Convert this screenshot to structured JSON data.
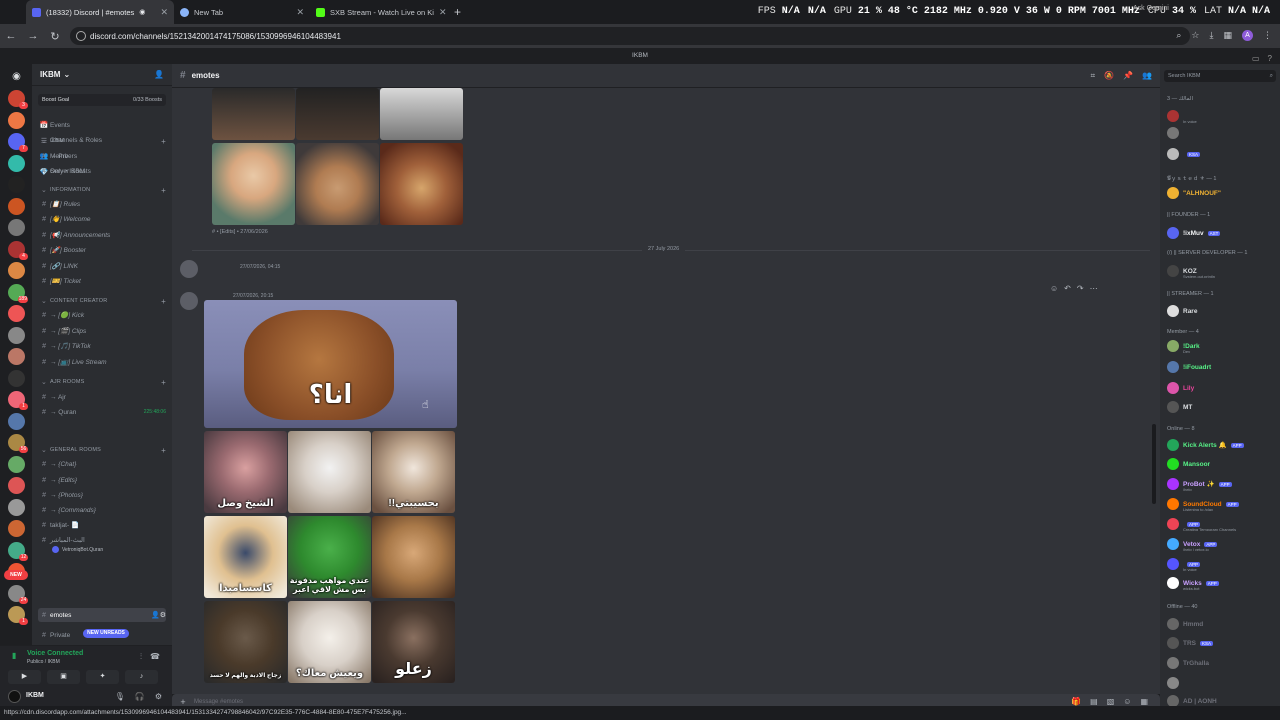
{
  "browser": {
    "tabs": [
      {
        "title": "(18332) Discord | #emotes",
        "color": "#5865f2"
      },
      {
        "title": "New Tab",
        "color": "#8ab4f8"
      },
      {
        "title": "SXB Stream - Watch Live on Ki",
        "color": "#53fc18"
      }
    ],
    "new_tab": "+",
    "ask": "Ask Gemini",
    "url": "discord.com/channels/1521342001474175086/1530996946104483941",
    "status_url": "https://cdn.discordapp.com/attachments/1530996946104483941/1531334274798846042/97C92E35-776C-4884-8E80-475E7F475256.jpg..."
  },
  "hud": [
    {
      "label": "FPS",
      "value": "N/A"
    },
    {
      "label": "N/A",
      "value": ""
    },
    {
      "label": "GPU",
      "value": "21 % 48 °C 2182 MHz 0.920 V 36 W 0 RPM 7001 MHz"
    },
    {
      "label": "CPU",
      "value": "34 %"
    },
    {
      "label": "LAT",
      "value": "N/A N/A"
    }
  ],
  "window_title": "IKBM",
  "server": {
    "name": "IKBM",
    "boost_goal": "Boost Goal",
    "boost_count": "0/33 Boosts",
    "top_items": [
      "Events",
      "Channels & Roles",
      "Members",
      "Server Boosts"
    ],
    "channels": [
      {
        "type": "cat",
        "label": "IKBM"
      },
      {
        "type": "ch",
        "label": "→ Prv"
      },
      {
        "type": "ch",
        "label": "Only • IKBM"
      },
      {
        "type": "cat",
        "label": "INFORMATION"
      },
      {
        "type": "ch",
        "label": "[📋] Rules"
      },
      {
        "type": "ch",
        "label": "[👋] Welcome"
      },
      {
        "type": "ch",
        "label": "[📢] Announcements"
      },
      {
        "type": "ch",
        "label": "[🚀] Booster"
      },
      {
        "type": "ch",
        "label": "[🔗] LINK"
      },
      {
        "type": "ch",
        "label": "[🎫] Ticket"
      },
      {
        "type": "cat",
        "label": "CONTENT CREATOR"
      },
      {
        "type": "ch",
        "label": "→ [🟢] Kick"
      },
      {
        "type": "ch",
        "label": "→ [🎬] Clips"
      },
      {
        "type": "ch",
        "label": "→ [🎵] TikTok"
      },
      {
        "type": "ch",
        "label": "→ [📺] Live Stream"
      },
      {
        "type": "cat",
        "label": "AJR ROOMS"
      },
      {
        "type": "ch",
        "label": "→ Ajr"
      },
      {
        "type": "ch",
        "label": "→ Quran",
        "extra": "225:48:06"
      },
      {
        "type": "cat",
        "label": "GENERAL ROOMS"
      },
      {
        "type": "ch",
        "label": "→ {Chat}"
      },
      {
        "type": "ch",
        "label": "→ {Edits}"
      },
      {
        "type": "ch",
        "label": "→ {Photos}"
      },
      {
        "type": "ch",
        "label": "→ {Commands}"
      },
      {
        "type": "ch",
        "label": "takljat- 📄"
      },
      {
        "type": "ch",
        "label": "البث-المباشر"
      }
    ],
    "voice_user": "VetroniqBot.Quran",
    "selected_channel": "emotes",
    "private_label": "Private",
    "new_unreads": "NEW UNREADS"
  },
  "voice": {
    "status": "Voice Connected",
    "sub": "Publico / IKBM"
  },
  "user": {
    "name": "IKBM"
  },
  "chat": {
    "channel": "emotes",
    "caption1": "# • [Edits] • 27/06/2026",
    "date_divider": "27 July 2026",
    "msg1_time": "27/07/2026, 04:15",
    "msg2_time": "27/07/2026, 20:15",
    "captions": {
      "big": "انا؟",
      "c1": "الشيخ وصل",
      "c3": "!!بحسيبتي",
      "c4": "كاسسامبدا",
      "c5": "عندي مواهب مدفونة بس مش لاقي اعبر",
      "c7": "زجاج الادبة والهم لا حسد",
      "c8": "ويعيش معاك؟",
      "c9": "زعلو"
    },
    "placeholder": "Message #emotes"
  },
  "members": {
    "search": "Search IKBM",
    "groups": [
      {
        "label": "المالك — 3"
      },
      {
        "label": "𝓖ｙｓｔｅｄ ⚜ — 1"
      },
      {
        "label": "|| FOUNDER — 1"
      },
      {
        "label": "(/) || SERVER DEVELOPER — 1"
      },
      {
        "label": "|| STREAMER — 1"
      },
      {
        "label": "Member — 4"
      },
      {
        "label": "Online — 8"
      },
      {
        "label": "Offline — 40"
      }
    ],
    "list": [
      {
        "name": "",
        "color": "#f23f43",
        "sub": "In voice"
      },
      {
        "name": "",
        "color": "#dbdee1",
        "sub": ""
      },
      {
        "name": "",
        "color": "#b5bac1",
        "tag": "KSA"
      },
      {
        "name": "\"ALHNOUF\"",
        "color": "#f0b232"
      },
      {
        "name": "!ixMuv",
        "color": "#f2f3f5",
        "tag": "AST"
      },
      {
        "name": "KOZ",
        "color": "#dbdee1",
        "sub": "System.out.println"
      },
      {
        "name": "Rare",
        "color": "#dbdee1"
      },
      {
        "name": "!Dark",
        "color": "#57f287",
        "sub": "Dev"
      },
      {
        "name": "!iFouadrt",
        "color": "#57f287"
      },
      {
        "name": "Lily",
        "color": "#eb459e"
      },
      {
        "name": "MT",
        "color": "#dbdee1"
      },
      {
        "name": "Kick Alerts 🔔",
        "color": "#57f287",
        "tag": "APP"
      },
      {
        "name": "Mansoor",
        "color": "#57f287"
      },
      {
        "name": "ProBot ✨",
        "color": "#c9a0ff",
        "tag": "APP",
        "sub": "/help"
      },
      {
        "name": "SoundCloud",
        "color": "#ff7a00",
        "tag": "APP",
        "sub": "Listening to /play"
      },
      {
        "name": "",
        "color": "#dbdee1",
        "tag": "APP",
        "sub": "Creating Temporary Channels"
      },
      {
        "name": "Vetox",
        "color": "#c9a0ff",
        "tag": "APP",
        "sub": "/help | vetox.io"
      },
      {
        "name": "",
        "color": "#dbdee1",
        "tag": "APP",
        "sub": "In voice"
      },
      {
        "name": "Wicks",
        "color": "#c9a0ff",
        "tag": "APP",
        "sub": "wicks.bot"
      },
      {
        "name": "Hmmd",
        "color": "#6d6f78"
      },
      {
        "name": "TRS",
        "color": "#6d6f78",
        "tag": "KSA"
      },
      {
        "name": "TrGhalla",
        "color": "#6d6f78"
      },
      {
        "name": "",
        "color": "#6d6f78"
      },
      {
        "name": "AD | AONH",
        "color": "#6d6f78"
      }
    ]
  },
  "colors": {
    "bg": "#313338",
    "sidebar": "#2b2d31",
    "accent": "#5865f2",
    "voice_green": "#23a55a",
    "new_red": "#f23f43"
  }
}
